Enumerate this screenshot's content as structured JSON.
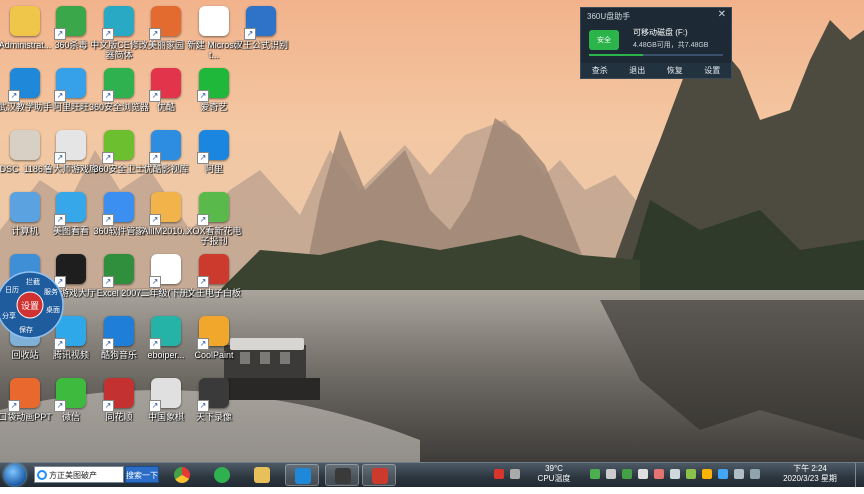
{
  "desktop": {
    "icons": [
      {
        "label": "Administrat...",
        "icon": "user-folder-icon",
        "color": "#f0c64a",
        "shortcut": false
      },
      {
        "label": "360杀毒",
        "icon": "shield-360-antivirus-icon",
        "color": "#3aa84a",
        "shortcut": true
      },
      {
        "label": "中文版CE修改器简体",
        "icon": "ce-shield-icon",
        "color": "#2aa9c4",
        "shortcut": true
      },
      {
        "label": "美丽家园",
        "icon": "house-icon",
        "color": "#e36b2f",
        "shortcut": true
      },
      {
        "label": "新建 Microsoft...",
        "icon": "word-document-icon",
        "color": "#ffffff",
        "shortcut": false
      },
      {
        "label": "汉王公式识别",
        "icon": "sigma-formula-icon",
        "color": "#2e73c7",
        "shortcut": true
      },
      {
        "label": "武汉教学助手",
        "icon": "teaching-assistant-icon",
        "color": "#1f88d8",
        "shortcut": true
      },
      {
        "label": "阿里旺旺",
        "icon": "aliwangwang-icon",
        "color": "#36a0e8",
        "shortcut": true
      },
      {
        "label": "360安全浏览器",
        "icon": "browser-360-icon",
        "color": "#2fb14f",
        "shortcut": true
      },
      {
        "label": "优酷",
        "icon": "youku-play-icon",
        "color": "#e2344a",
        "shortcut": true
      },
      {
        "label": "爱奇艺",
        "icon": "iqiyi-icon",
        "color": "#1fb83a",
        "shortcut": true
      },
      {
        "label": "DSC_1186...",
        "icon": "photo-file-icon",
        "color": "#d8d0c4",
        "shortcut": false
      },
      {
        "label": "鲁大师游戏库",
        "icon": "gamepad-icon",
        "color": "#e5e5e5",
        "shortcut": true
      },
      {
        "label": "360安全卫士",
        "icon": "security-guard-plus-icon",
        "color": "#6cbf2f",
        "shortcut": true
      },
      {
        "label": "优酷影视库",
        "icon": "youku-folder-icon",
        "color": "#2d8de0",
        "shortcut": true
      },
      {
        "label": "阿里",
        "icon": "dingtalk-icon",
        "color": "#1a86e0",
        "shortcut": true
      },
      {
        "label": "计算机",
        "icon": "computer-icon",
        "color": "#5aa3e0",
        "shortcut": false
      },
      {
        "label": "美图看看",
        "icon": "meitu-viewer-icon",
        "color": "#36a7e8",
        "shortcut": true
      },
      {
        "label": "360软件管家",
        "icon": "software-manager-icon",
        "color": "#3b8ff0",
        "shortcut": true
      },
      {
        "label": "AliIM2010...",
        "icon": "aliim-installer-icon",
        "color": "#f2b34b",
        "shortcut": true
      },
      {
        "label": "XOX看新花电子报刊",
        "icon": "green-face-icon",
        "color": "#59b94a",
        "shortcut": true
      },
      {
        "label": "",
        "icon": "network-globe-icon",
        "color": "#3f8fd6",
        "shortcut": false
      },
      {
        "label": "QQ游戏大厅",
        "icon": "qq-penguin-icon",
        "color": "#1e1e1e",
        "shortcut": true
      },
      {
        "label": "Excel 2007",
        "icon": "excel-icon",
        "color": "#2f8f3c",
        "shortcut": true
      },
      {
        "label": "二年级(下册)",
        "icon": "document-file-icon",
        "color": "#ffffff",
        "shortcut": true
      },
      {
        "label": "文王电子白板",
        "icon": "whiteboard-icon",
        "color": "#cc3a2e",
        "shortcut": true
      },
      {
        "label": "回收站",
        "icon": "recycle-bin-icon",
        "color": "#7fb0d8",
        "shortcut": false
      },
      {
        "label": "腾讯视频",
        "icon": "tencent-video-icon",
        "color": "#2ea8e8",
        "shortcut": true
      },
      {
        "label": "酷狗音乐",
        "icon": "kugou-icon",
        "color": "#1e7ed8",
        "shortcut": true
      },
      {
        "label": "eboiper...",
        "icon": "shield-check-icon",
        "color": "#25b3a8",
        "shortcut": true
      },
      {
        "label": "CoolPaint",
        "icon": "coolpaint-icon",
        "color": "#f0a72c",
        "shortcut": true
      },
      {
        "label": "口袋动画PPT",
        "icon": "pocket-ppt-icon",
        "color": "#e8682e",
        "shortcut": true
      },
      {
        "label": "微信",
        "icon": "wechat-icon",
        "color": "#3ebb3e",
        "shortcut": true
      },
      {
        "label": "同花顺",
        "icon": "cards-icon",
        "color": "#c43131",
        "shortcut": true
      },
      {
        "label": "中国象棋",
        "icon": "network-tool-icon",
        "color": "#e0e0e0",
        "shortcut": true
      },
      {
        "label": "天下录像",
        "icon": "video-camera-icon",
        "color": "#3a3a3a",
        "shortcut": true
      }
    ]
  },
  "usb_panel": {
    "title": "360U盘助手",
    "close": "✕",
    "drive_badge": "安全",
    "drive_name": "可移动磁盘 (F:)",
    "capacity": "4.48GB可用，共7.48GB",
    "used_fraction": 0.4,
    "actions": [
      "查杀",
      "退出",
      "恢复",
      "设置"
    ]
  },
  "float_ball": {
    "center": "设置",
    "segments": [
      "拦截",
      "服务",
      "桌面",
      "保存",
      "分享",
      "日历"
    ]
  },
  "taskbar": {
    "search_text": "方正美图破产",
    "search_button": "搜索一下",
    "temperature": "39°C",
    "temperature_label": "CPU温度",
    "time": "下午 2:24",
    "date": "2020/3/23 星期一"
  }
}
